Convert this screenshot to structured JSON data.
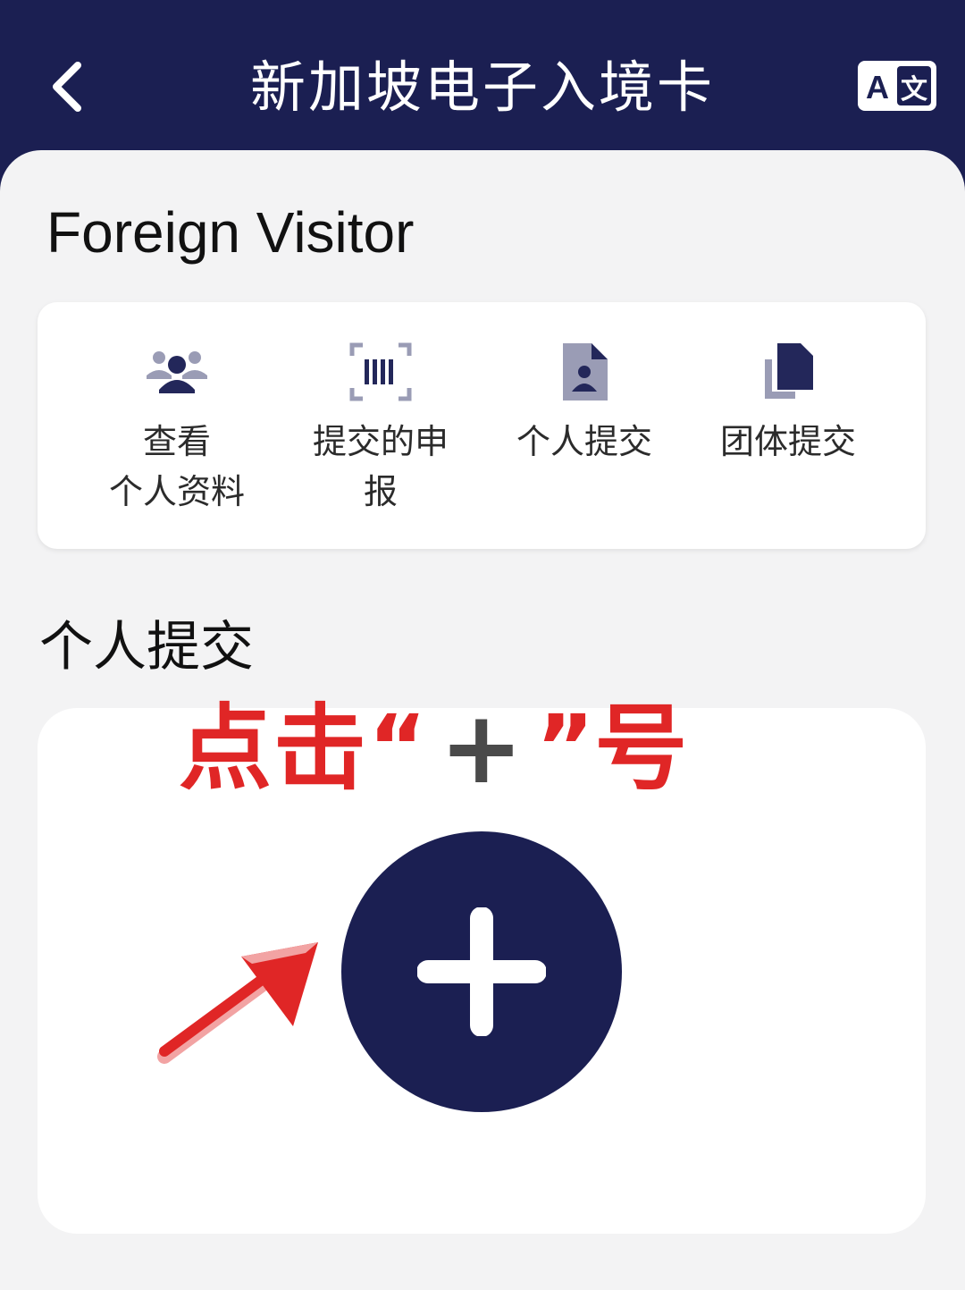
{
  "header": {
    "title": "新加坡电子入境卡",
    "lang_icon_text_a": "A",
    "lang_icon_text_b": "文",
    "bg_color": "#1b1f52"
  },
  "page": {
    "title": "Foreign Visitor"
  },
  "menu": {
    "items": [
      {
        "label": "查看\n个人资料",
        "icon": "users-icon"
      },
      {
        "label": "提交的申\n报",
        "icon": "barcode-scan-icon"
      },
      {
        "label": "个人提交",
        "icon": "person-document-icon"
      },
      {
        "label": "团体提交",
        "icon": "copy-documents-icon"
      }
    ]
  },
  "section": {
    "title": "个人提交"
  },
  "annotation": {
    "prefix": "点击",
    "open_quote": "“",
    "plus": "+",
    "close_quote": "”",
    "suffix": "号",
    "color": "#e02626"
  },
  "colors": {
    "accent": "#1b1f52",
    "icon": "#4b4f77",
    "sheet_bg": "#f3f3f4"
  }
}
